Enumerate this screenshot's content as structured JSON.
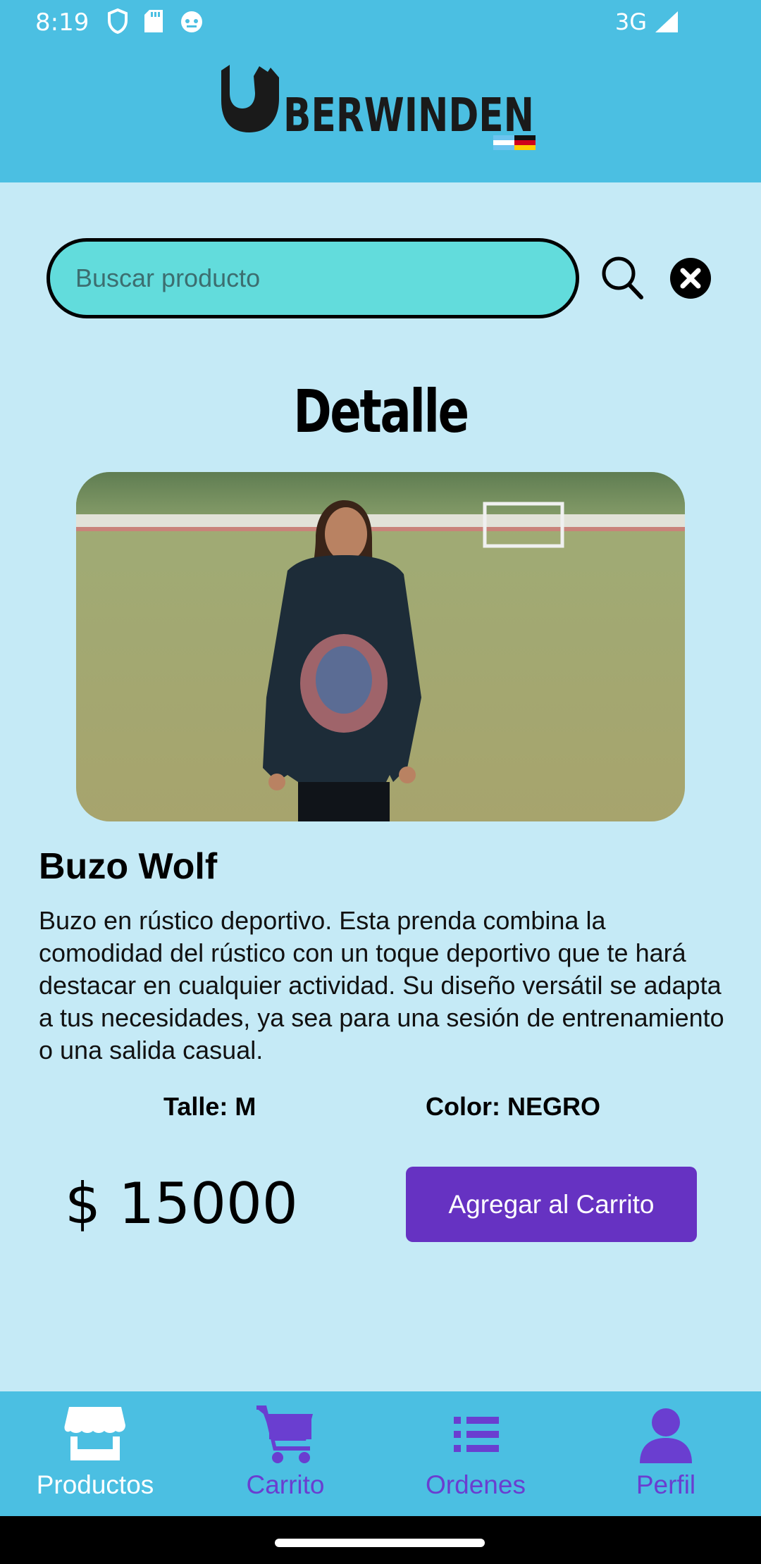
{
  "status_bar": {
    "time": "8:19",
    "network": "3G",
    "icons": [
      "shield-icon",
      "sd-card-icon",
      "robot-face-icon",
      "signal-icon"
    ]
  },
  "header": {
    "logo_text": "BERWINDEN",
    "logo_icon": "wolf-u-logo-icon"
  },
  "search": {
    "placeholder": "Buscar producto",
    "value": "",
    "search_icon": "search-icon",
    "clear_icon": "close-circle-icon"
  },
  "page": {
    "title": "Detalle"
  },
  "product": {
    "image_desc": "photo",
    "name": "Buzo Wolf",
    "description": "Buzo en rústico deportivo. Esta prenda combina la comodidad del rústico con un toque deportivo que te hará destacar en cualquier actividad. Su diseño versátil se adapta a tus necesidades, ya sea para una sesión de entrenamiento o una salida casual.",
    "size_text": "Talle: M",
    "color_text": "Color: NEGRO",
    "price": "$ 15000",
    "add_to_cart_label": "Agregar al Carrito"
  },
  "bottom_nav": {
    "items": [
      {
        "label": "Productos",
        "icon": "store-icon",
        "active": true
      },
      {
        "label": "Carrito",
        "icon": "cart-icon",
        "active": false
      },
      {
        "label": "Ordenes",
        "icon": "list-icon",
        "active": false
      },
      {
        "label": "Perfil",
        "icon": "user-icon",
        "active": false
      }
    ]
  },
  "colors": {
    "header_bg": "#4bbfe2",
    "page_bg": "#c5eaf6",
    "search_bg": "#62dcdc",
    "accent": "#6632c2",
    "nav_inactive": "#6a3ed0"
  }
}
